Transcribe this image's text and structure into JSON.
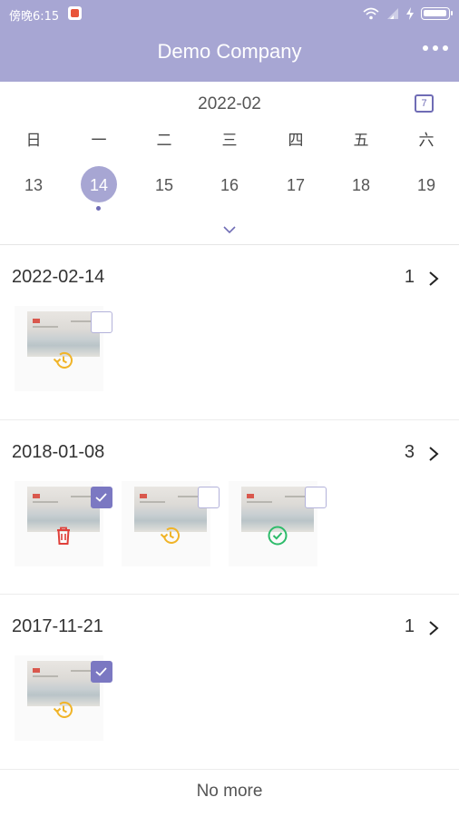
{
  "status_bar": {
    "time": "傍晚6:15"
  },
  "header": {
    "title": "Demo Company",
    "more_icon": "more-icon"
  },
  "calendar": {
    "month": "2022-02",
    "calendar_icon_text": "7",
    "weekdays": [
      "日",
      "一",
      "二",
      "三",
      "四",
      "五",
      "六"
    ],
    "days": [
      "13",
      "14",
      "15",
      "16",
      "17",
      "18",
      "19"
    ],
    "selected_day": "14"
  },
  "groups": [
    {
      "date": "2022-02-14",
      "count": "1",
      "items": [
        {
          "checked": false,
          "status": "pending"
        }
      ]
    },
    {
      "date": "2018-01-08",
      "count": "3",
      "items": [
        {
          "checked": true,
          "status": "deleted"
        },
        {
          "checked": false,
          "status": "pending"
        },
        {
          "checked": false,
          "status": "approved"
        }
      ]
    },
    {
      "date": "2017-11-21",
      "count": "1",
      "items": [
        {
          "checked": true,
          "status": "pending"
        }
      ]
    }
  ],
  "footer": {
    "text": "No more"
  },
  "colors": {
    "header": "#a7a6d3",
    "accent": "#7b78c2",
    "pending": "#f0b429",
    "deleted": "#e0403a",
    "approved": "#2dbb6a"
  }
}
